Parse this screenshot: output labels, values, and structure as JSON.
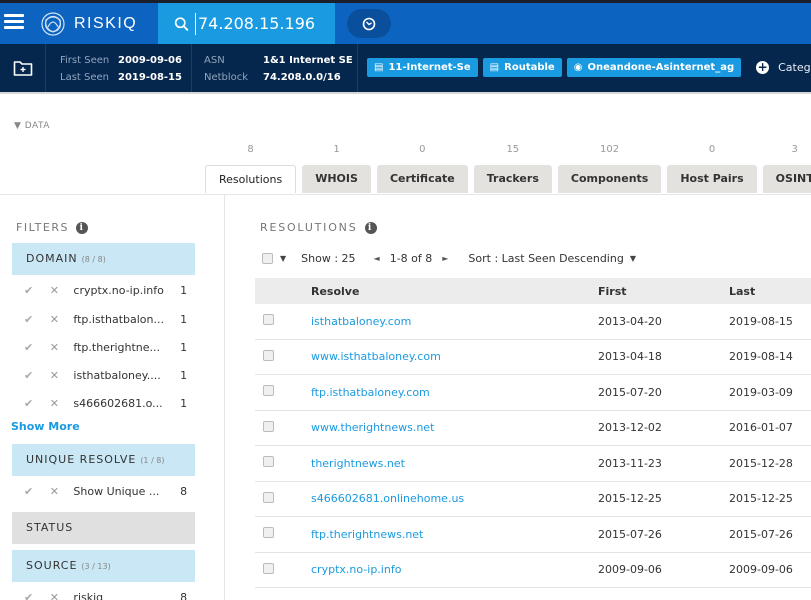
{
  "topbar": {
    "brand": "RISKIQ",
    "search_value": "74.208.15.196",
    "icons": {
      "menu": "hamburger-icon",
      "logo": "riskiq-logo-icon",
      "search": "search-icon",
      "history": "clock-icon"
    }
  },
  "infobar": {
    "first_seen_label": "First Seen",
    "first_seen_value": "2009-09-06",
    "last_seen_label": "Last Seen",
    "last_seen_value": "2019-08-15",
    "asn_label": "ASN",
    "asn_value": "1&1 Internet SE",
    "netblock_label": "Netblock",
    "netblock_value": "74.208.0.0/16",
    "tags": [
      {
        "icon": "building-icon",
        "label": "11-Internet-Se"
      },
      {
        "icon": "building-icon",
        "label": "Routable"
      },
      {
        "icon": "globe-icon",
        "label": "Oneandone-Asinternet_ag"
      }
    ],
    "categorize_label": "Categoriz"
  },
  "data_section": {
    "toggle_label": "▼ DATA",
    "tabs": [
      {
        "count": "8",
        "label": "Resolutions",
        "active": true
      },
      {
        "count": "1",
        "label": "WHOIS"
      },
      {
        "count": "0",
        "label": "Certificate"
      },
      {
        "count": "15",
        "label": "Trackers"
      },
      {
        "count": "102",
        "label": "Components"
      },
      {
        "count": "0",
        "label": "Host Pairs"
      },
      {
        "count": "3",
        "label": "OSINT"
      }
    ]
  },
  "filters": {
    "title": "FILTERS",
    "domain_group": {
      "label": "DOMAIN",
      "sub": "(8 / 8)"
    },
    "domain_items": [
      {
        "name": "cryptx.no-ip.info",
        "count": "1"
      },
      {
        "name": "ftp.isthatbalon...",
        "count": "1"
      },
      {
        "name": "ftp.therightne...",
        "count": "1"
      },
      {
        "name": "isthatbaloney....",
        "count": "1"
      },
      {
        "name": "s466602681.o...",
        "count": "1"
      }
    ],
    "show_more": "Show More",
    "unique_group": {
      "label": "UNIQUE RESOLVE",
      "sub": "(1 / 8)"
    },
    "unique_items": [
      {
        "name": "Show Unique ...",
        "count": "8"
      }
    ],
    "status_group": {
      "label": "STATUS"
    },
    "source_group": {
      "label": "SOURCE",
      "sub": "(3 / 13)"
    },
    "source_items": [
      {
        "name": "riskiq",
        "count": "8"
      }
    ]
  },
  "resolutions": {
    "title": "RESOLUTIONS",
    "show_label": "Show : 25",
    "range_label": "1-8 of 8",
    "sort_label": "Sort : Last Seen Descending",
    "columns": {
      "resolve": "Resolve",
      "first": "First",
      "last": "Last"
    },
    "rows": [
      {
        "resolve": "isthatbaloney.com",
        "first": "2013-04-20",
        "last": "2019-08-15"
      },
      {
        "resolve": "www.isthatbaloney.com",
        "first": "2013-04-18",
        "last": "2019-08-14"
      },
      {
        "resolve": "ftp.isthatbaloney.com",
        "first": "2015-07-20",
        "last": "2019-03-09"
      },
      {
        "resolve": "www.therightnews.net",
        "first": "2013-12-02",
        "last": "2016-01-07"
      },
      {
        "resolve": "therightnews.net",
        "first": "2013-11-23",
        "last": "2015-12-28"
      },
      {
        "resolve": "s466602681.onlinehome.us",
        "first": "2015-12-25",
        "last": "2015-12-25"
      },
      {
        "resolve": "ftp.therightnews.net",
        "first": "2015-07-26",
        "last": "2015-07-26"
      },
      {
        "resolve": "cryptx.no-ip.info",
        "first": "2009-09-06",
        "last": "2009-09-06"
      }
    ]
  }
}
